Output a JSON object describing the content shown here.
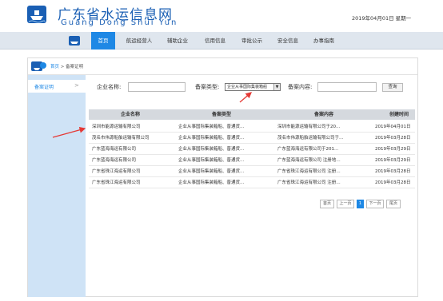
{
  "header": {
    "title": "广东省水运信息网",
    "subtitle": "Guang Dong Shui Yun",
    "date": "2019年04月01日 星期一",
    "logo_icon": "ship-logo-icon"
  },
  "nav": {
    "items": [
      {
        "label": "首页",
        "active": true
      },
      {
        "label": "航运经营人"
      },
      {
        "label": "辅助企业"
      },
      {
        "label": "信用信息"
      },
      {
        "label": "审批公示"
      },
      {
        "label": "安全信息"
      },
      {
        "label": "办事指南"
      }
    ]
  },
  "breadcrumb": {
    "home": "首页",
    "separator": ">",
    "current": "备案证明"
  },
  "sidebar": {
    "items": [
      {
        "label": "备案证明",
        "chevron": ">"
      }
    ]
  },
  "filters": {
    "company_label": "企业名称:",
    "company_value": "",
    "type_label": "备案类型:",
    "type_selected": "企业从事国际集装箱船",
    "content_label": "备案内容:",
    "content_value": "",
    "query_button": "查询"
  },
  "table": {
    "headers": [
      "企业名称",
      "备案类型",
      "备案内容",
      "创建时间"
    ],
    "rows": [
      [
        "深圳市能源运输有限公司",
        "企业从事国际集装箱船、普通货…",
        "深圳市能源运输有限公司于20…",
        "2019年04月01日"
      ],
      [
        "茂名市伟源船舶运输有限公司",
        "企业从事国际集装箱船、普通货…",
        "茂名市伟源船舶运输有限公司于…",
        "2019年03月28日"
      ],
      [
        "广东蓝海海运有限公司",
        "企业从事国际集装箱船、普通货…",
        "广东蓝海海运有限公司于201…",
        "2019年03月29日"
      ],
      [
        "广东蓝海海运有限公司",
        "企业从事国际集装箱船、普通货…",
        "广东蓝海海运有限公司 注册地…",
        "2019年03月29日"
      ],
      [
        "广东省珠江海运有限公司",
        "企业从事国际集装箱船、普通货…",
        "广东省珠江海运有限公司 注册…",
        "2019年03月28日"
      ],
      [
        "广东省珠江海运有限公司",
        "企业从事国际集装箱船、普通货…",
        "广东省珠江海运有限公司 注册…",
        "2019年03月28日"
      ]
    ]
  },
  "pager": {
    "first": "首页",
    "prev": "上一页",
    "current": "1",
    "next": "下一页",
    "last": "尾页"
  },
  "colors": {
    "accent": "#1e88e5",
    "title": "#1a5fb4",
    "sidebar": "#cfe3f6",
    "annotation": "#e53935"
  }
}
